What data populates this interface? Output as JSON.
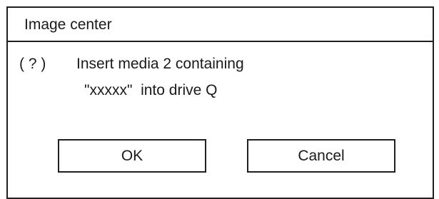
{
  "dialog": {
    "title": "Image center",
    "icon": {
      "name": "question-icon",
      "glyph": "( ? )"
    },
    "message": {
      "line1": "Insert media 2 containing",
      "line2": "\"xxxxx\"  into drive Q"
    },
    "buttons": {
      "ok_label": "OK",
      "cancel_label": "Cancel"
    }
  }
}
